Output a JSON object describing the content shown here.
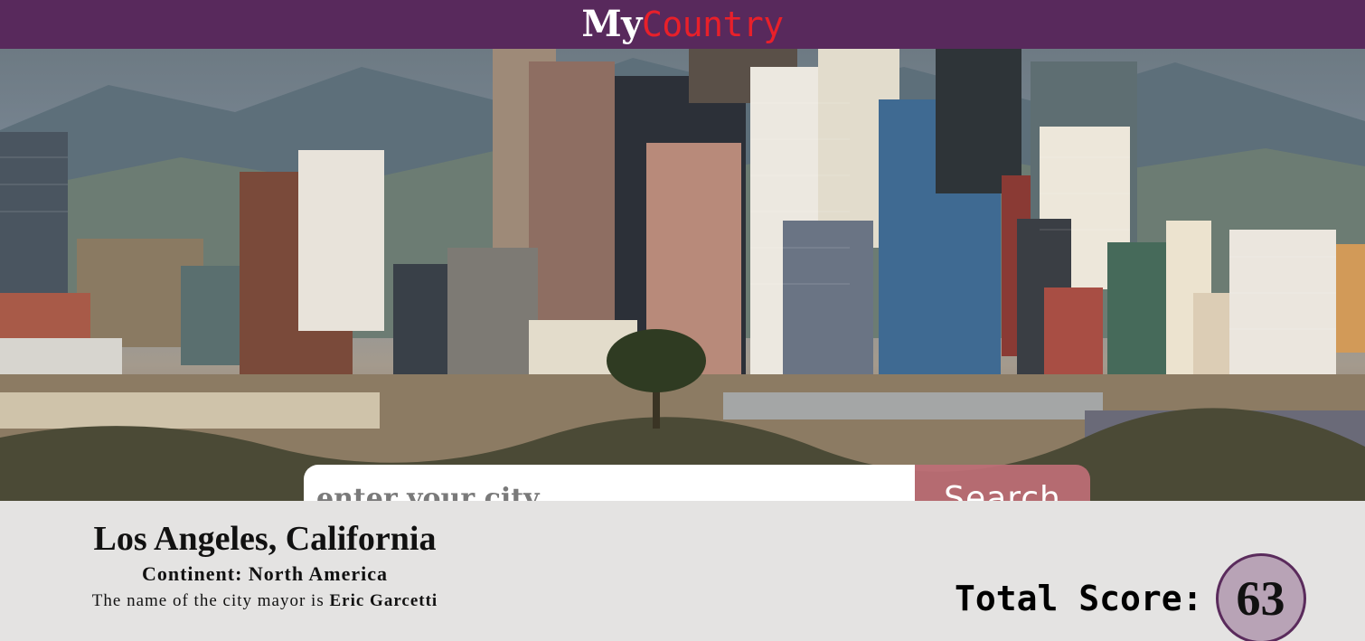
{
  "header": {
    "brand_part1": "My",
    "brand_part2": "Country",
    "brand_colors": {
      "part1": "#ffffff",
      "part2": "#e8202a",
      "bar": "#58295c"
    }
  },
  "search": {
    "placeholder": "enter your city",
    "button_label": "Search"
  },
  "city": {
    "name": "Los Angeles, California",
    "continent_label": "Continent:",
    "continent_value": "North America",
    "mayor_prefix": "The name of the city mayor is",
    "mayor_name": "Eric Garcetti"
  },
  "score": {
    "label": "Total Score:",
    "value": "63"
  }
}
